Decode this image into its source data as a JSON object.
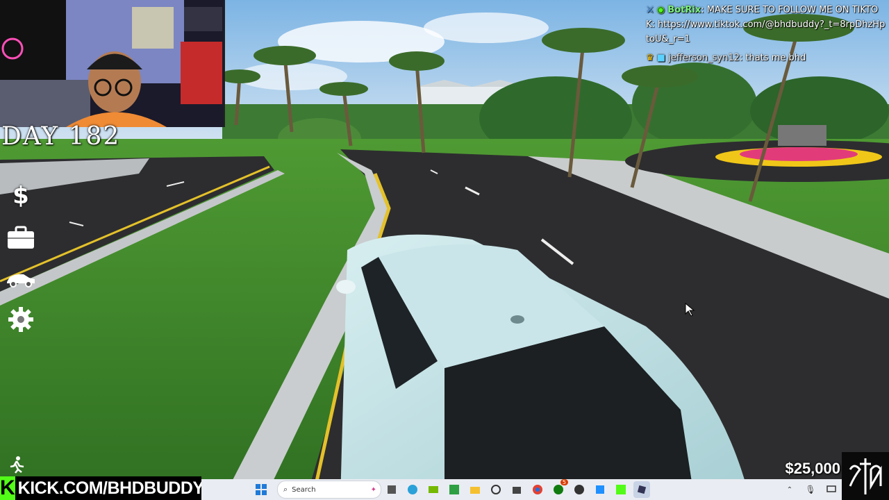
{
  "overlay": {
    "day_label": "DAY 182",
    "money": "$25,000",
    "kick_url": "KICK.COM/BHDBUDDY"
  },
  "hud": [
    {
      "name": "money-icon",
      "glyph": "$"
    },
    {
      "name": "briefcase-icon"
    },
    {
      "name": "car-icon"
    },
    {
      "name": "gear-icon"
    }
  ],
  "chat": [
    {
      "user": "BotRix",
      "message": "MAKE SURE TO FOLLOW ME ON TIKTOK: https://www.tiktok.com/@bhdbuddy?_t=8rpDhzHptoU&_r=1"
    },
    {
      "user": "jefferson_syn12",
      "message": "thats me bhd"
    }
  ],
  "taskbar": {
    "search_placeholder": "Search",
    "notification_count": "5"
  },
  "colors": {
    "kick_green": "#53fc18",
    "grass": "#3f8a2c",
    "road": "#2d2d2f",
    "car": "#bfe0e4"
  }
}
